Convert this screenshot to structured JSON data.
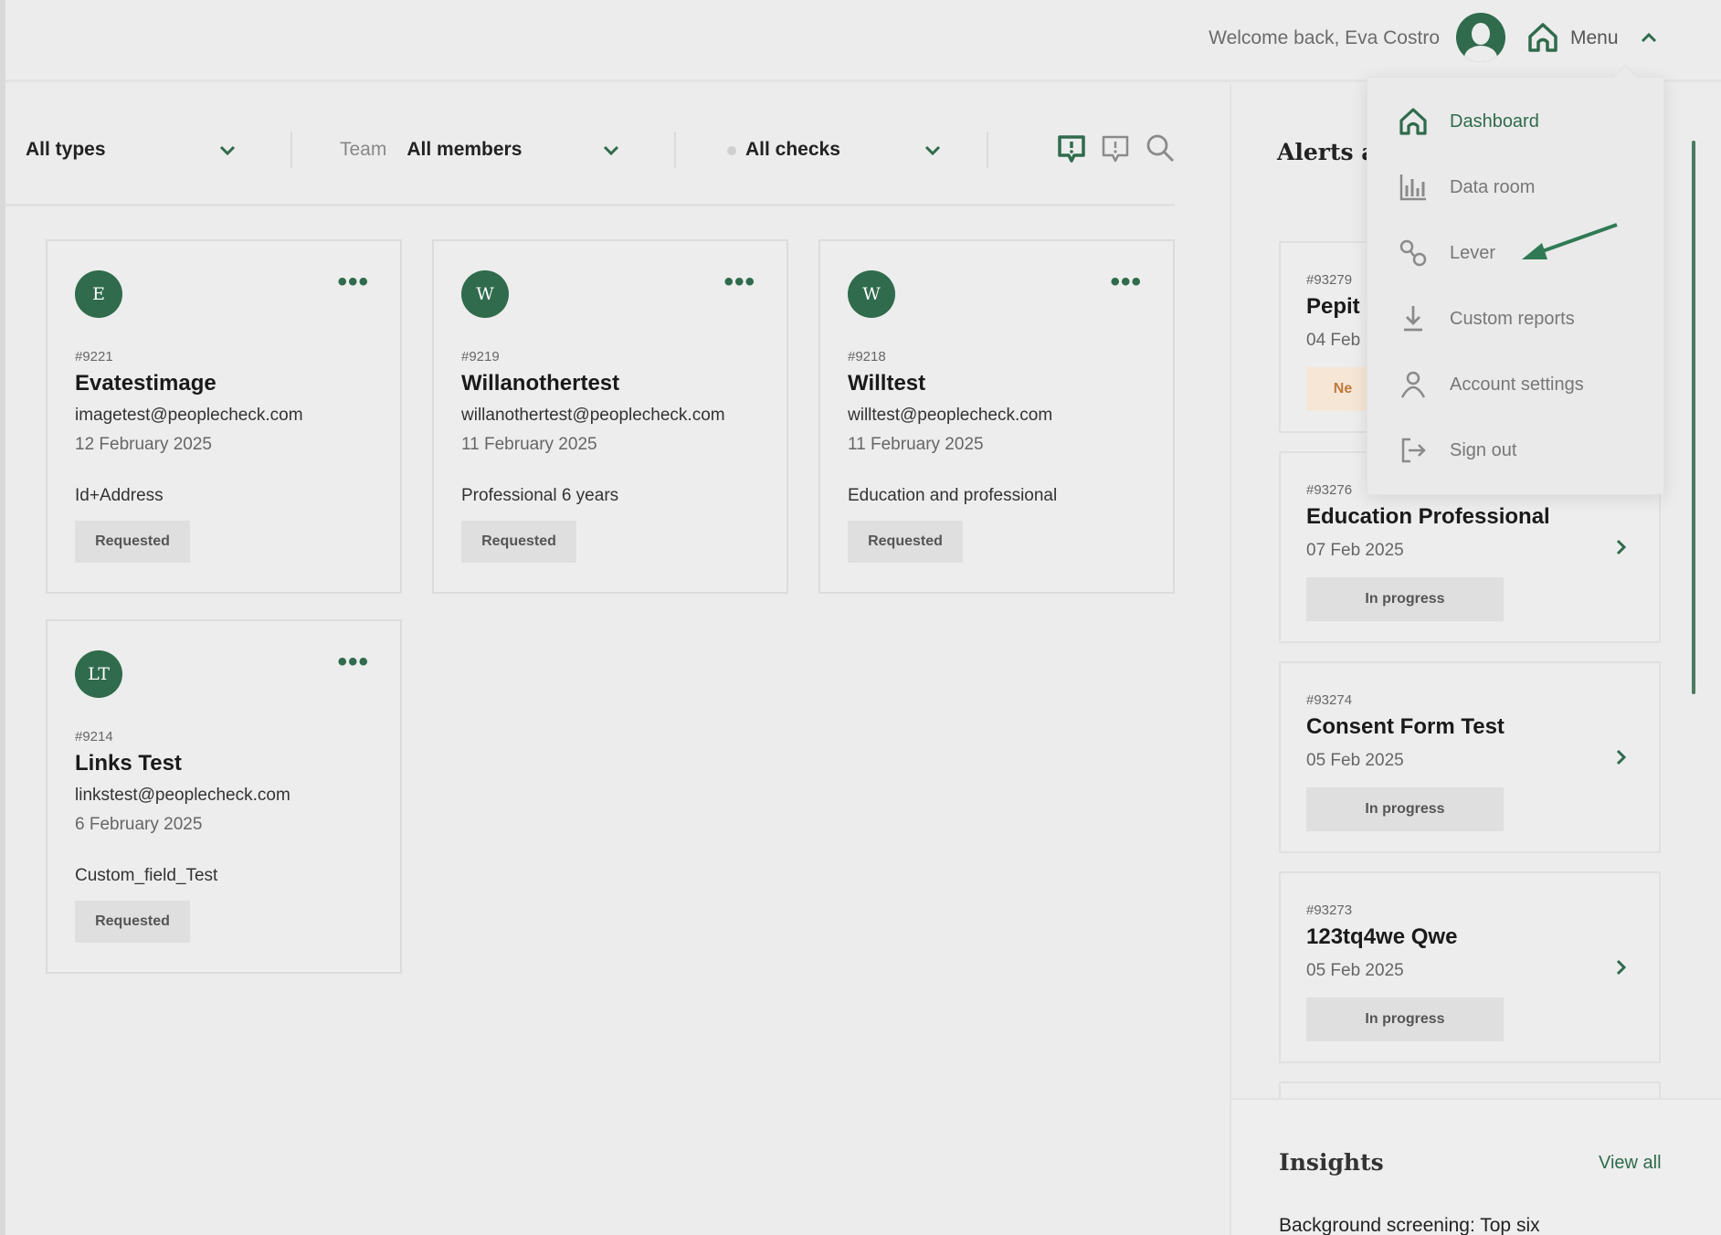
{
  "header": {
    "welcome": "Welcome back, Eva Costro",
    "menu_label": "Menu"
  },
  "menu": {
    "items": [
      {
        "label": "Dashboard",
        "icon": "home-icon",
        "active": true
      },
      {
        "label": "Data room",
        "icon": "chart-icon",
        "active": false
      },
      {
        "label": "Lever",
        "icon": "link-icon",
        "active": false
      },
      {
        "label": "Custom reports",
        "icon": "download-icon",
        "active": false
      },
      {
        "label": "Account settings",
        "icon": "user-icon",
        "active": false
      },
      {
        "label": "Sign out",
        "icon": "sign-out-icon",
        "active": false
      }
    ]
  },
  "filters": {
    "type_value": "All types",
    "team_label": "Team",
    "team_value": "All members",
    "checks_value": "All checks"
  },
  "cards": [
    {
      "initial": "E",
      "number": "#9221",
      "name": "Evatestimage",
      "email": "imagetest@peoplecheck.com",
      "date": "12 February 2025",
      "type": "Id+Address",
      "status": "Requested"
    },
    {
      "initial": "W",
      "number": "#9219",
      "name": "Willanothertest",
      "email": "willanothertest@peoplecheck.com",
      "date": "11 February 2025",
      "type": "Professional 6 years",
      "status": "Requested"
    },
    {
      "initial": "W",
      "number": "#9218",
      "name": "Willtest",
      "email": "willtest@peoplecheck.com",
      "date": "11 February 2025",
      "type": "Education and professional",
      "status": "Requested"
    },
    {
      "initial": "LT",
      "number": "#9214",
      "name": "Links Test",
      "email": "linkstest@peoplecheck.com",
      "date": "6 February 2025",
      "type": "Custom_field_Test",
      "status": "Requested"
    }
  ],
  "alerts": {
    "title": "Alerts a",
    "items": [
      {
        "number": "#93279",
        "name": "Pepit",
        "date": "04 Feb",
        "status": "Ne"
      },
      {
        "number": "#93276",
        "name": "Education Professional",
        "date": "07 Feb 2025",
        "status": "In progress"
      },
      {
        "number": "#93274",
        "name": "Consent Form Test",
        "date": "05 Feb 2025",
        "status": "In progress"
      },
      {
        "number": "#93273",
        "name": "123tq4we Qwe",
        "date": "05 Feb 2025",
        "status": "In progress"
      }
    ]
  },
  "insights": {
    "title": "Insights",
    "view_all": "View all",
    "text": "Background screening: Top six"
  },
  "colors": {
    "brand_green": "#2f6b4c",
    "background": "#ececec"
  }
}
